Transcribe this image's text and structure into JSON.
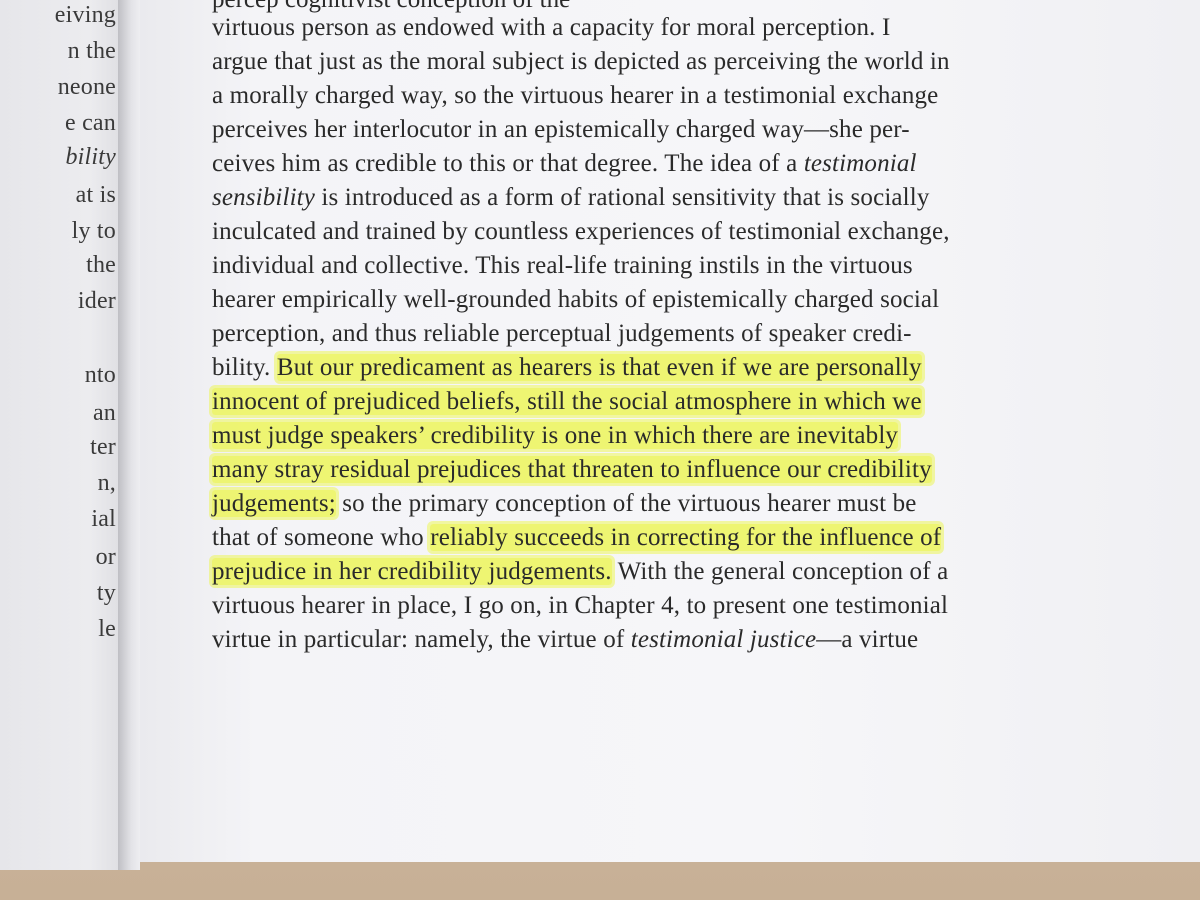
{
  "left_page": {
    "lines": [
      {
        "text": "eiving",
        "italic": false
      },
      {
        "text": "n the",
        "italic": false
      },
      {
        "text": "neone",
        "italic": false
      },
      {
        "text": "e can",
        "italic": false
      },
      {
        "text": "bility",
        "italic": true
      },
      {
        "text": "at is",
        "italic": false
      },
      {
        "text": "ly to",
        "italic": false
      },
      {
        "text": "the",
        "italic": false
      },
      {
        "text": "ider",
        "italic": false
      },
      {
        "text": "nto",
        "italic": false
      },
      {
        "text": "an",
        "italic": false
      },
      {
        "text": "ter",
        "italic": false
      },
      {
        "text": "n,",
        "italic": false
      },
      {
        "text": "ial",
        "italic": false
      },
      {
        "text": "or",
        "italic": false
      },
      {
        "text": "ty",
        "italic": false
      },
      {
        "text": "le",
        "italic": false
      }
    ]
  },
  "right_page": {
    "clipped_top_line": "percep                                      cognitivist conception of the",
    "lines": [
      {
        "segments": [
          {
            "t": "virtuous person as endowed with a capacity for moral perception. I"
          }
        ]
      },
      {
        "segments": [
          {
            "t": "argue that just as the moral subject is depicted as perceiving the world in"
          }
        ]
      },
      {
        "segments": [
          {
            "t": "a morally charged way, so the virtuous hearer in a testimonial exchange"
          }
        ]
      },
      {
        "segments": [
          {
            "t": "perceives her interlocutor in an epistemically charged way—she per-"
          }
        ]
      },
      {
        "segments": [
          {
            "t": "ceives him as credible to this or that degree. The idea of a "
          },
          {
            "t": "testimonial",
            "i": true
          }
        ]
      },
      {
        "segments": [
          {
            "t": "sensibility",
            "i": true
          },
          {
            "t": " is introduced as a form of rational sensitivity that is socially"
          }
        ]
      },
      {
        "segments": [
          {
            "t": "inculcated and trained by countless experiences of testimonial exchange,"
          }
        ]
      },
      {
        "segments": [
          {
            "t": "individual and collective. This real-life training instils in the virtuous"
          }
        ]
      },
      {
        "segments": [
          {
            "t": "hearer empirically well-grounded habits of epistemically charged social"
          }
        ]
      },
      {
        "segments": [
          {
            "t": "perception, and thus reliable perceptual judgements of speaker credi-"
          }
        ]
      },
      {
        "segments": [
          {
            "t": "bility. "
          },
          {
            "t": "But our predicament as hearers is that even if we are personally",
            "h": true
          }
        ]
      },
      {
        "segments": [
          {
            "t": "innocent of prejudiced beliefs, still the social atmosphere in which we",
            "h": true
          }
        ]
      },
      {
        "segments": [
          {
            "t": "must judge speakers’ credibility is one in which there are inevitably",
            "h": true
          }
        ]
      },
      {
        "segments": [
          {
            "t": "many stray residual prejudices that threaten to influence our credibility",
            "h": true
          }
        ]
      },
      {
        "segments": [
          {
            "t": "judgements;",
            "h": true
          },
          {
            "t": " so the primary conception of the virtuous hearer must be"
          }
        ]
      },
      {
        "segments": [
          {
            "t": "that of someone who "
          },
          {
            "t": "reliably succeeds in correcting for the influence of",
            "h": true
          }
        ]
      },
      {
        "segments": [
          {
            "t": "prejudice in her credibility judgements.",
            "h": true
          },
          {
            "t": " With the general conception of a"
          }
        ]
      },
      {
        "segments": [
          {
            "t": "virtuous hearer in place, I go on, in Chapter 4, to present one testimonial"
          }
        ]
      },
      {
        "segments": [
          {
            "t": "virtue in particular: namely, the virtue of "
          },
          {
            "t": "testimonial justice",
            "i": true
          },
          {
            "t": "—a virtue"
          }
        ]
      }
    ]
  },
  "colors": {
    "highlight": "#ecf55a",
    "ink": "#2a2a2a",
    "paper": "#f4f4f7",
    "table": "#c9b59f"
  }
}
